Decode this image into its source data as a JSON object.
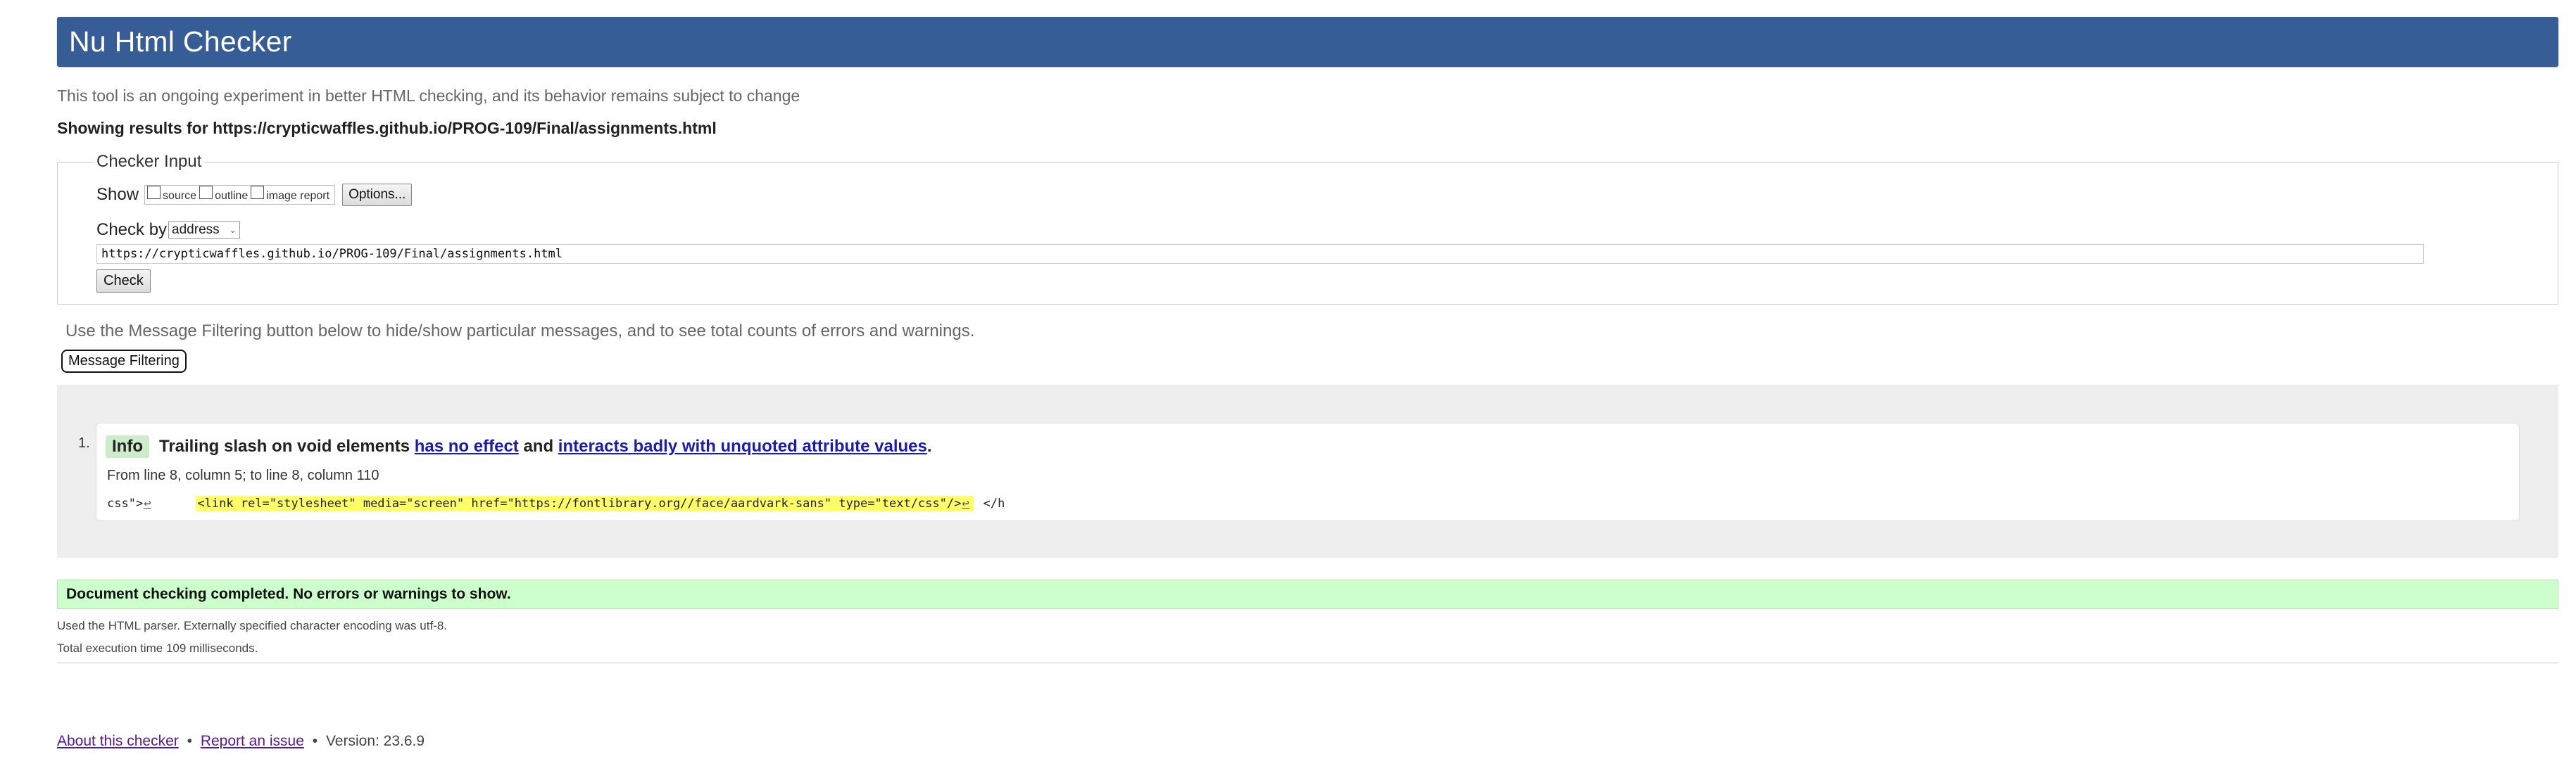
{
  "header": {
    "title": "Nu Html Checker"
  },
  "subtitle": "This tool is an ongoing experiment in better HTML checking, and its behavior remains subject to change",
  "showing": "Showing results for https://crypticwaffles.github.io/PROG-109/Final/assignments.html",
  "checker": {
    "legend": "Checker Input",
    "show_label": "Show",
    "options": [
      {
        "label": "source",
        "checked": false
      },
      {
        "label": "outline",
        "checked": false
      },
      {
        "label": "image report",
        "checked": false
      }
    ],
    "options_button": "Options...",
    "check_by_label": "Check by",
    "check_by_value": "address",
    "url_value": "https://crypticwaffles.github.io/PROG-109/Final/assignments.html",
    "check_button": "Check"
  },
  "filter": {
    "hint": "Use the Message Filtering button below to hide/show particular messages, and to see total counts of errors and warnings.",
    "button": "Message Filtering"
  },
  "messages": [
    {
      "number": "1.",
      "type": "Info",
      "text_before": "Trailing slash on void elements ",
      "link1": "has no effect",
      "text_middle": " and ",
      "link2": "interacts badly with unquoted attribute values",
      "text_after": ".",
      "location": "From line 8, column 5; to line 8, column 110",
      "code_before": "css\">",
      "code_highlight": "<link rel=\"stylesheet\" media=\"screen\" href=\"https://fontlibrary.org//face/aardvark-sans\" type=\"text/css\"/>",
      "code_after": "</h",
      "lf_glyph": "↩"
    }
  ],
  "status": {
    "done": "Document checking completed. No errors or warnings to show.",
    "parser": "Used the HTML parser. Externally specified character encoding was utf-8.",
    "exec": "Total execution time 109 milliseconds."
  },
  "footer": {
    "about": "About this checker",
    "bullet": "•",
    "report": "Report an issue",
    "version": "Version: 23.6.9"
  },
  "colors": {
    "header": "#365d95",
    "info_badge": "#cdeccc",
    "success": "#ccffcc",
    "highlight": "#ffff66"
  }
}
